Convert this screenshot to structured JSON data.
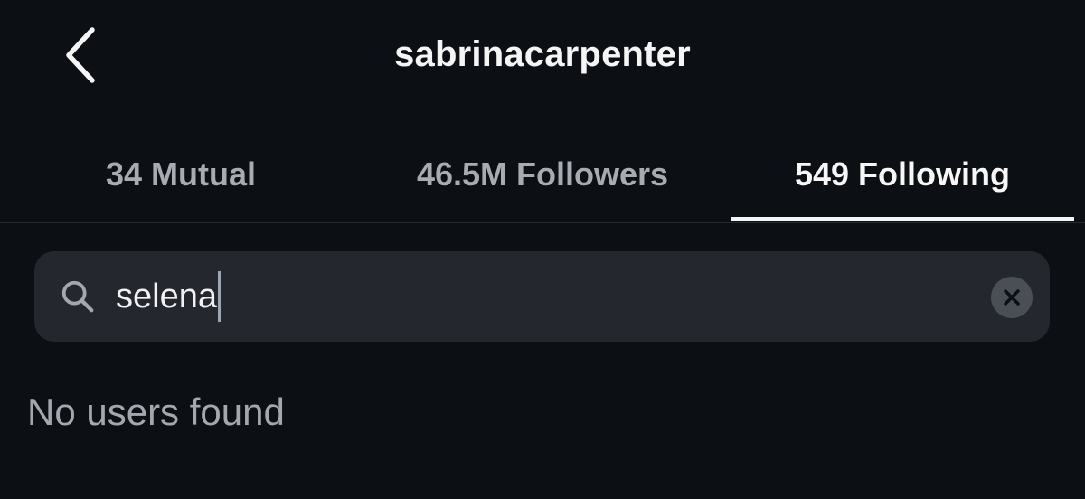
{
  "header": {
    "title": "sabrinacarpenter",
    "back_icon": "chevron-left-icon"
  },
  "tabs": [
    {
      "label": "34 Mutual",
      "active": false
    },
    {
      "label": "46.5M Followers",
      "active": false
    },
    {
      "label": "549 Following",
      "active": true
    }
  ],
  "search": {
    "value": "selena",
    "icon": "search-icon",
    "clear_icon": "close-icon"
  },
  "results": {
    "empty_message": "No users found"
  },
  "colors": {
    "background": "#0c0f14",
    "search_bg": "#24272d",
    "active_text": "#f5f5f5",
    "inactive_text": "#a7acb3"
  }
}
